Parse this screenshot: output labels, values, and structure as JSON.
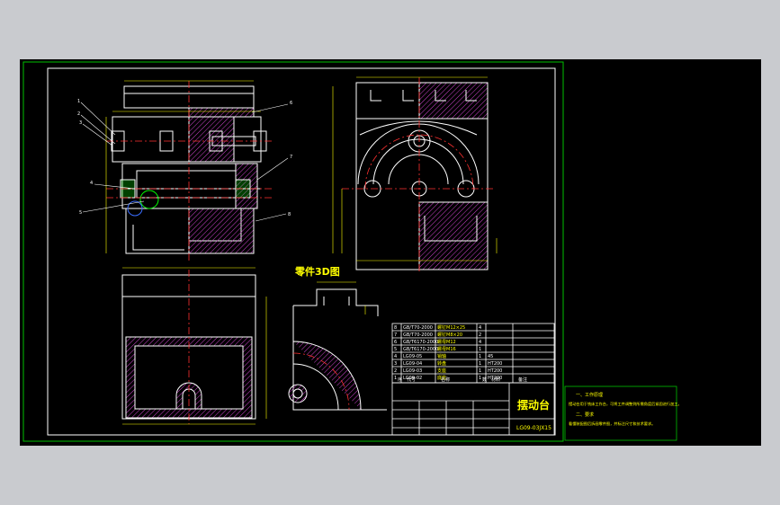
{
  "colors": {
    "page": "#c9cbcf",
    "sheet": "#000000",
    "frame": "#ffffff",
    "border_green": "#00c000",
    "geometry": "#ffffff",
    "centerline": "#ff3030",
    "dimension": "#ffff00",
    "hatch": "#cc44cc",
    "section_green": "#00ff00",
    "text_yellow": "#ffff00",
    "text_cyan": "#00ffff",
    "note_border": "#00c000"
  },
  "drawing": {
    "part_3d_label": "零件3D图",
    "title_name": "摆动台",
    "drawing_no": "LG09-03JX15",
    "leaders": [
      "1",
      "2",
      "3",
      "4",
      "5",
      "6",
      "7",
      "8"
    ]
  },
  "bom": {
    "header": [
      "序",
      "代号",
      "名称",
      "数",
      "材料",
      "备注"
    ],
    "rows": [
      [
        "8",
        "GB/T70-2000",
        "螺钉M12×25",
        "4",
        "",
        ""
      ],
      [
        "7",
        "GB/T70-2000",
        "螺钉M8×20",
        "2",
        "",
        ""
      ],
      [
        "6",
        "GB/T6170-2000",
        "螺母M12",
        "4",
        "",
        ""
      ],
      [
        "5",
        "GB/T6170-2000",
        "螺母M16",
        "1",
        "",
        ""
      ],
      [
        "4",
        "LG09-05",
        "销轴",
        "1",
        "45",
        ""
      ],
      [
        "3",
        "LG09-04",
        "转盘",
        "1",
        "HT200",
        ""
      ],
      [
        "2",
        "LG09-03",
        "支座",
        "1",
        "HT200",
        ""
      ],
      [
        "1",
        "LG09-02",
        "底座",
        "1",
        "HT200",
        ""
      ]
    ]
  },
  "notes": {
    "h1": "一、工作原理",
    "p1": "摆动台用于铣床工作台，可将工件调整到所需角度后紧固进行加工。",
    "h2": "二、要求",
    "p2": "看懂装配图后拆画零件图，并标注尺寸和技术要求。"
  }
}
